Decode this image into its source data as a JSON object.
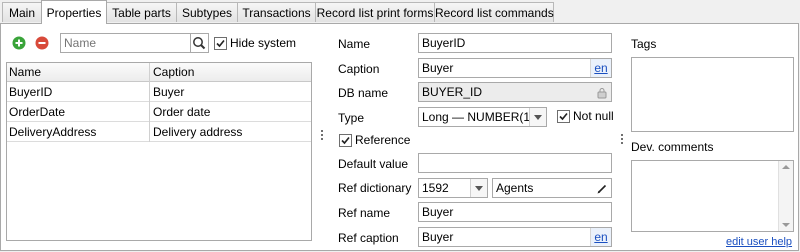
{
  "tabs": [
    "Main",
    "Properties",
    "Table parts",
    "Subtypes",
    "Transactions",
    "Record list print forms",
    "Record list commands"
  ],
  "left": {
    "search_placeholder": "Name",
    "hide_system_label": "Hide system",
    "hide_system_checked": true,
    "columns": [
      "Name",
      "Caption"
    ],
    "rows": [
      {
        "name": "BuyerID",
        "caption": "Buyer"
      },
      {
        "name": "OrderDate",
        "caption": "Order date"
      },
      {
        "name": "DeliveryAddress",
        "caption": "Delivery address"
      }
    ]
  },
  "form": {
    "name_label": "Name",
    "name_value": "BuyerID",
    "caption_label": "Caption",
    "caption_value": "Buyer",
    "lang_link": "en",
    "dbname_label": "DB name",
    "dbname_value": "BUYER_ID",
    "type_label": "Type",
    "type_value": "Long — NUMBER(18)",
    "not_null_label": "Not null",
    "not_null_checked": true,
    "reference_label": "Reference",
    "reference_checked": true,
    "default_label": "Default value",
    "default_value": "",
    "refdict_label": "Ref dictionary",
    "refdict_id": "1592",
    "refdict_name": "Agents",
    "refname_label": "Ref name",
    "refname_value": "Buyer",
    "refcaption_label": "Ref caption",
    "refcaption_value": "Buyer"
  },
  "right": {
    "tags_label": "Tags",
    "devcomments_label": "Dev. comments",
    "help_link": "edit user help"
  },
  "colors": {
    "add": "#3aa43a",
    "remove": "#d84a3a",
    "link": "#1a4fc0"
  },
  "icons": [
    "add-icon",
    "remove-icon",
    "search-icon",
    "lock-icon",
    "edit-icon",
    "chevron-down-icon",
    "check-icon"
  ]
}
